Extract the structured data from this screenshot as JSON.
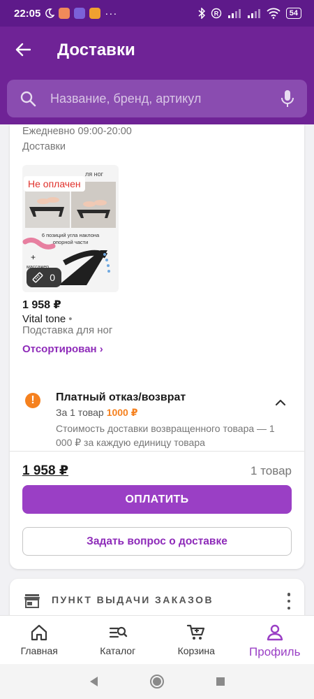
{
  "status_bar": {
    "time": "22:05",
    "battery": "54"
  },
  "appbar": {
    "title": "Доставки"
  },
  "search": {
    "placeholder": "Название, бренд, артикул"
  },
  "delivery": {
    "hours": "Ежедневно 09:00-20:00",
    "label": "Доставки",
    "product": {
      "unpaid_badge": "Не оплачен",
      "image_caption_top": "ля ног",
      "image_caption_mid": "6 позиций угла наклона опорной части",
      "image_caption_bottom": "массажер",
      "count": "0",
      "price": "1 958 ₽",
      "brand": "Vital tone",
      "brand_sep": "•",
      "name": "Подставка для ног",
      "status": "Отсортирован ›"
    },
    "refund": {
      "title": "Платный отказ/возврат",
      "per_item": "За 1 товар",
      "amount": "1000 ₽",
      "description": "Стоимость доставки возвращенного товара — 1 000 ₽ за каждую единицу товара"
    },
    "total": {
      "sum": "1 958 ₽",
      "items": "1 товар"
    },
    "pay_button": "ОПЛАТИТЬ",
    "ask_button": "Задать вопрос о доставке"
  },
  "pickup": {
    "label": "ПУНКТ ВЫДАЧИ ЗАКАЗОВ"
  },
  "bottom_nav": [
    {
      "label": "Главная",
      "icon": "home-icon"
    },
    {
      "label": "Каталог",
      "icon": "catalog-search-icon"
    },
    {
      "label": "Корзина",
      "icon": "cart-icon"
    },
    {
      "label": "Профиль",
      "icon": "profile-icon",
      "active": true
    }
  ],
  "colors": {
    "brand": "#6f2396",
    "accent": "#9a3fc5",
    "link": "#8e2bb9",
    "warning": "#f5811f",
    "error": "#e0312b"
  }
}
